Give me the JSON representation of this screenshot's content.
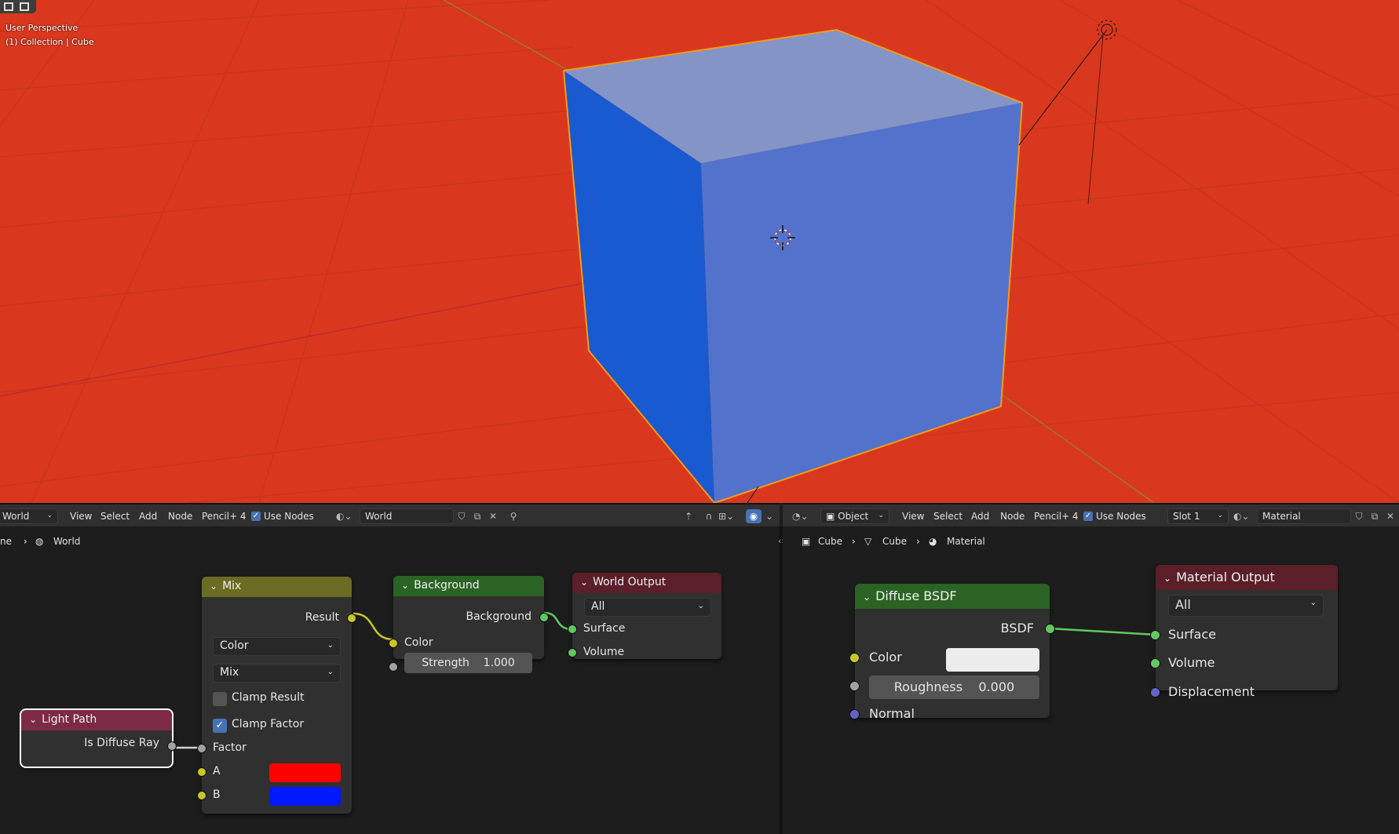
{
  "viewport": {
    "perspective_label": "User Perspective",
    "collection_label": "(1) Collection | Cube",
    "background_color": "#d9381e",
    "cube_front_color": "#5272cc",
    "cube_left_color": "#1a5ad0",
    "cube_top_color": "#8494c7",
    "selection_outline_color": "#f29a1a"
  },
  "left_header": {
    "editor_type_value": "World",
    "menu": [
      "View",
      "Select",
      "Add",
      "Node",
      "Pencil+ 4"
    ],
    "use_nodes_label": "Use Nodes",
    "world_value": "World"
  },
  "right_header": {
    "object_mode_value": "Object",
    "menu": [
      "View",
      "Select",
      "Add",
      "Node",
      "Pencil+ 4"
    ],
    "use_nodes_label": "Use Nodes",
    "slot_value": "Slot 1",
    "material_value": "Material"
  },
  "left_breadcrumb": {
    "scene_fragment": "ne",
    "world": "World"
  },
  "right_breadcrumb": {
    "object": "Cube",
    "mesh": "Cube",
    "material": "Material"
  },
  "nodes_world": {
    "light_path": {
      "title": "Light Path",
      "output": "Is Diffuse Ray",
      "header_color": "#7c2a47"
    },
    "mix": {
      "title": "Mix",
      "output": "Result",
      "data_type": "Color",
      "blend_mode": "Mix",
      "clamp_result_label": "Clamp Result",
      "clamp_result_checked": false,
      "clamp_factor_label": "Clamp Factor",
      "clamp_factor_checked": true,
      "factor_label": "Factor",
      "a_label": "A",
      "b_label": "B",
      "a_color": "#ff0000",
      "b_color": "#0019ff",
      "header_color": "#6b6b24"
    },
    "background": {
      "title": "Background",
      "output": "Background",
      "color_label": "Color",
      "strength_label": "Strength",
      "strength_value": "1.000",
      "header_color": "#2b6324"
    },
    "world_output": {
      "title": "World Output",
      "target": "All",
      "surface_label": "Surface",
      "volume_label": "Volume",
      "header_color": "#5a1f29"
    }
  },
  "nodes_material": {
    "diffuse": {
      "title": "Diffuse BSDF",
      "output": "BSDF",
      "color_label": "Color",
      "color_value": "#ececec",
      "roughness_label": "Roughness",
      "roughness_value": "0.000",
      "normal_label": "Normal",
      "header_color": "#2b6324"
    },
    "material_output": {
      "title": "Material Output",
      "target": "All",
      "surface_label": "Surface",
      "volume_label": "Volume",
      "displacement_label": "Displacement",
      "header_color": "#5a1f29"
    }
  }
}
